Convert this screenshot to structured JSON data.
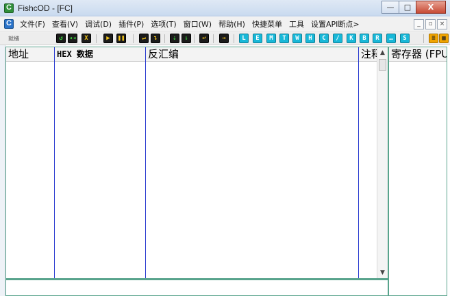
{
  "window": {
    "title": "FishcOD - [FC]",
    "controls": [
      "—",
      "□",
      "X"
    ]
  },
  "menubar": {
    "items": [
      "文件(F)",
      "查看(V)",
      "调试(D)",
      "插件(P)",
      "选项(T)",
      "窗口(W)",
      "帮助(H)",
      "快捷菜单",
      "工具",
      "设置API断点>"
    ],
    "mdi_controls": [
      "_",
      "▫",
      "×"
    ]
  },
  "toolbar": {
    "label": "就绪",
    "buttons": [
      {
        "name": "restart-icon",
        "glyph": "↺",
        "style": "dark"
      },
      {
        "name": "rewind-icon",
        "glyph": "◂◂",
        "style": "dark"
      },
      {
        "name": "close-process-icon",
        "glyph": "X",
        "style": "yellow"
      },
      {
        "name": "run-icon",
        "glyph": "▶",
        "style": "yellow"
      },
      {
        "name": "pause-icon",
        "glyph": "❚❚",
        "style": "yellow"
      },
      {
        "name": "step-into-icon",
        "glyph": "↵",
        "style": "yellow"
      },
      {
        "name": "step-over-icon",
        "glyph": "↴",
        "style": "yellow"
      },
      {
        "name": "trace-into-icon",
        "glyph": "⇣",
        "style": "dark"
      },
      {
        "name": "trace-over-icon",
        "glyph": "⇂",
        "style": "dark"
      },
      {
        "name": "execute-till-return-icon",
        "glyph": "↩",
        "style": "yellow"
      },
      {
        "name": "goto-icon",
        "glyph": "→",
        "style": "yellow"
      },
      {
        "name": "window-l",
        "glyph": "L",
        "style": "cyan"
      },
      {
        "name": "window-e",
        "glyph": "E",
        "style": "cyan"
      },
      {
        "name": "window-m",
        "glyph": "M",
        "style": "cyan"
      },
      {
        "name": "window-t",
        "glyph": "T",
        "style": "cyan"
      },
      {
        "name": "window-w",
        "glyph": "W",
        "style": "cyan"
      },
      {
        "name": "window-h",
        "glyph": "H",
        "style": "cyan"
      },
      {
        "name": "window-c",
        "glyph": "C",
        "style": "cyan"
      },
      {
        "name": "window-slash",
        "glyph": "/",
        "style": "cyan"
      },
      {
        "name": "window-k",
        "glyph": "K",
        "style": "cyan"
      },
      {
        "name": "window-b",
        "glyph": "B",
        "style": "cyan"
      },
      {
        "name": "window-r",
        "glyph": "R",
        "style": "cyan"
      },
      {
        "name": "window-dots",
        "glyph": "…",
        "style": "cyan"
      },
      {
        "name": "window-s",
        "glyph": "S",
        "style": "cyan"
      },
      {
        "name": "options-icon",
        "glyph": "≡",
        "style": "orange"
      },
      {
        "name": "appearance-icon",
        "glyph": "▦",
        "style": "orange"
      }
    ]
  },
  "cpu_pane": {
    "columns": {
      "address": "地址",
      "hex": "HEX 数据",
      "disasm": "反汇编",
      "comment": "注释"
    },
    "scroll": {
      "up": "▲",
      "down": "▼"
    }
  },
  "registers_pane": {
    "header": "寄存器 (FPU)"
  },
  "colors": {
    "pane_border": "#58a38c",
    "column_line": "#2a3bd0",
    "titlebar": "#c9daef",
    "close_button": "#c74a35"
  }
}
